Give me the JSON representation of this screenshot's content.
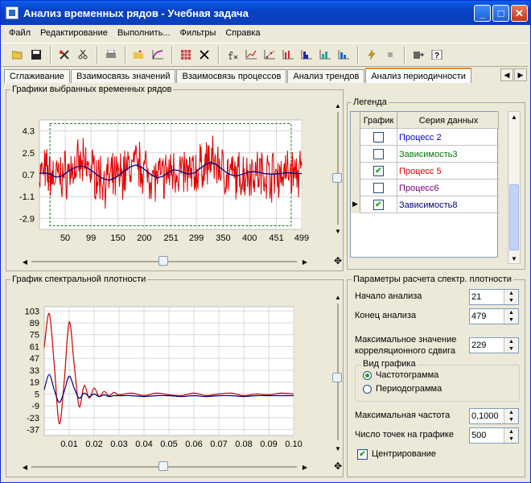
{
  "window": {
    "title": "Анализ временных рядов - Учебная задача"
  },
  "menu": [
    "Файл",
    "Редактирование",
    "Выполнить...",
    "Фильтры",
    "Справка"
  ],
  "tabs": [
    "Сглаживание",
    "Взаимосвязь значений",
    "Взаимосвязь процессов",
    "Анализ трендов",
    "Анализ периодичности"
  ],
  "active_tab": "Анализ периодичности",
  "timeseries_panel": {
    "title": "Графики выбранных временных рядов"
  },
  "legend_panel": {
    "title": "Легенда",
    "col_plot": "График",
    "col_series": "Серия данных",
    "rows": [
      {
        "name": "Процесс 2",
        "checked": false,
        "color": "#0000cc",
        "current": false
      },
      {
        "name": "Зависимость3",
        "checked": false,
        "color": "#007a00",
        "current": false
      },
      {
        "name": "Процесс 5",
        "checked": true,
        "color": "#e00000",
        "current": false
      },
      {
        "name": "Процесс6",
        "checked": false,
        "color": "#7a007a",
        "current": false
      },
      {
        "name": "Зависимость8",
        "checked": true,
        "color": "#000080",
        "current": true
      }
    ]
  },
  "spectral_panel": {
    "title": "График спектральной плотности"
  },
  "params": {
    "title": "Параметры расчета спектр. плотности",
    "start_label": "Начало анализа",
    "start_value": "21",
    "end_label": "Конец анализа",
    "end_value": "479",
    "maxshift_label_1": "Максимальное значение",
    "maxshift_label_2": "корреляционного сдвига",
    "maxshift_value": "229",
    "view_group": "Вид графика",
    "view_option_1": "Частотограмма",
    "view_option_2": "Периодограмма",
    "view_selected": "Частотограмма",
    "maxfreq_label": "Максимальная частота",
    "maxfreq_value": "0,1000",
    "points_label": "Число точек на графике",
    "points_value": "500",
    "center_label": "Центрирование",
    "center_checked": true
  },
  "chart_data": [
    {
      "type": "line",
      "x_ticks": [
        "50",
        "99",
        "150",
        "200",
        "251",
        "299",
        "350",
        "400",
        "451",
        "499"
      ],
      "y_ticks": [
        "4.3",
        "2.5",
        "0.7",
        "-1.1",
        "-2.9"
      ],
      "xlim": [
        1,
        499
      ],
      "ylim": [
        -3.8,
        5.2
      ],
      "grid": true,
      "series": [
        {
          "color": "#e00000",
          "noise_amplitude": 1.5,
          "values": [
            0.8,
            0.9,
            0.7,
            0.5,
            0.6,
            0.8,
            1.1,
            1.3,
            1.4,
            1.3,
            1.0,
            0.6,
            0.3,
            0.2,
            0.3,
            0.6,
            1.0,
            1.3,
            1.5,
            1.4,
            1.0,
            0.6,
            0.4,
            0.5,
            0.8,
            1.1,
            1.0,
            0.8,
            0.7,
            0.8,
            1.2,
            1.6,
            1.8,
            1.6,
            1.2,
            0.8,
            0.6,
            0.5,
            0.7,
            0.9,
            1.0,
            0.9,
            0.8,
            0.7,
            0.7,
            0.8,
            0.9,
            0.9,
            0.8,
            0.8
          ]
        },
        {
          "color": "#000080",
          "values": [
            0.8,
            0.85,
            0.75,
            0.5,
            0.55,
            0.85,
            1.15,
            1.35,
            1.4,
            1.25,
            0.95,
            0.6,
            0.35,
            0.25,
            0.4,
            0.7,
            1.05,
            1.35,
            1.5,
            1.35,
            1.0,
            0.65,
            0.45,
            0.55,
            0.85,
            1.1,
            1.05,
            0.85,
            0.75,
            0.85,
            1.2,
            1.55,
            1.7,
            1.55,
            1.2,
            0.85,
            0.65,
            0.6,
            0.75,
            0.9,
            0.95,
            0.9,
            0.8,
            0.75,
            0.75,
            0.8,
            0.85,
            0.85,
            0.8,
            0.8
          ]
        }
      ]
    },
    {
      "type": "line",
      "x_ticks": [
        "0.01",
        "0.02",
        "0.03",
        "0.04",
        "0.05",
        "0.06",
        "0.07",
        "0.08",
        "0.09",
        "0.10"
      ],
      "y_ticks": [
        "103",
        "89",
        "75",
        "61",
        "47",
        "33",
        "19",
        "5",
        "-9",
        "-23",
        "-37"
      ],
      "xlim": [
        0,
        0.1
      ],
      "ylim": [
        -44,
        108
      ],
      "grid": true,
      "series": [
        {
          "color": "#cc0000",
          "x": [
            0,
            0.002,
            0.004,
            0.006,
            0.008,
            0.01,
            0.012,
            0.014,
            0.016,
            0.018,
            0.02,
            0.022,
            0.024,
            0.026,
            0.028,
            0.03,
            0.035,
            0.04,
            0.045,
            0.05,
            0.055,
            0.06,
            0.065,
            0.07,
            0.075,
            0.08,
            0.085,
            0.09,
            0.095,
            0.1
          ],
          "values": [
            60,
            100,
            40,
            -30,
            20,
            90,
            40,
            -10,
            15,
            0,
            12,
            2,
            8,
            3,
            7,
            4,
            6,
            3,
            6,
            4,
            3,
            6,
            3,
            5,
            6,
            3,
            5,
            4,
            6,
            5
          ]
        },
        {
          "color": "#000080",
          "x": [
            0,
            0.002,
            0.004,
            0.006,
            0.008,
            0.01,
            0.012,
            0.014,
            0.016,
            0.018,
            0.02,
            0.022,
            0.024,
            0.026,
            0.028,
            0.03,
            0.035,
            0.04,
            0.045,
            0.05,
            0.055,
            0.06,
            0.065,
            0.07,
            0.075,
            0.08,
            0.085,
            0.09,
            0.095,
            0.1
          ],
          "values": [
            10,
            28,
            10,
            -5,
            8,
            26,
            12,
            0,
            6,
            2,
            5,
            2,
            4,
            2,
            3,
            3,
            3,
            2,
            3,
            3,
            2,
            3,
            2,
            3,
            3,
            2,
            3,
            3,
            3,
            3
          ]
        }
      ]
    }
  ]
}
